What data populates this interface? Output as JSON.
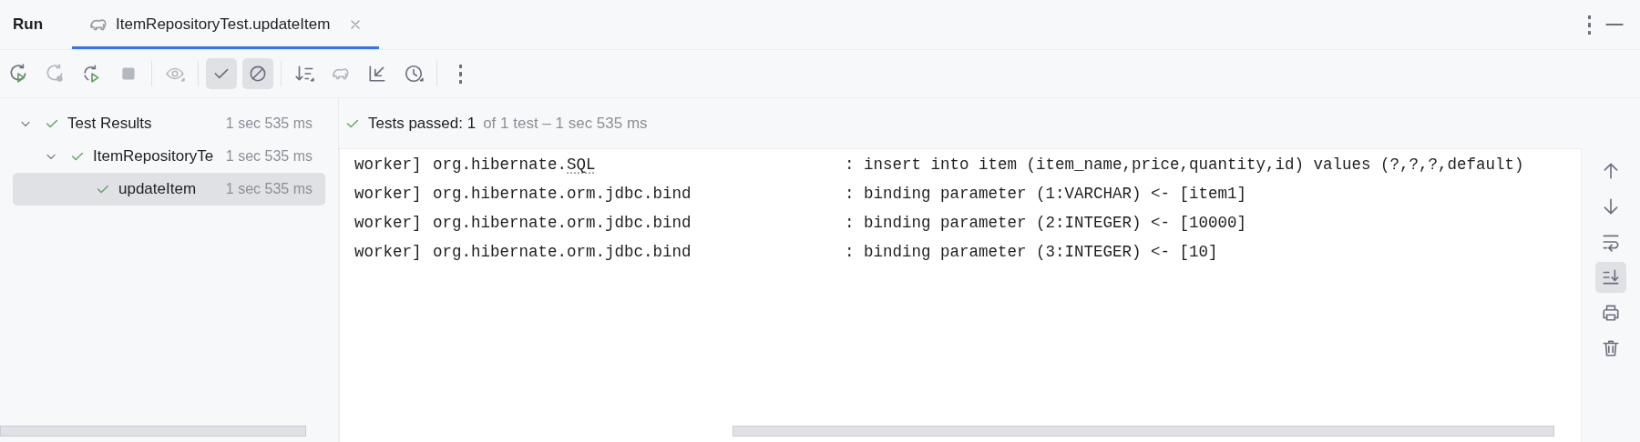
{
  "tool_window": {
    "title": "Run"
  },
  "tabs": [
    {
      "label": "ItemRepositoryTest.updateItem",
      "selected": true
    }
  ],
  "toolbar": [
    {
      "kind": "rerun",
      "disabled": false,
      "selected": false
    },
    {
      "kind": "rerun-failed",
      "disabled": true,
      "selected": false
    },
    {
      "kind": "toggle-auto-test",
      "disabled": false,
      "selected": false
    },
    {
      "kind": "stop",
      "disabled": true,
      "selected": false
    },
    {
      "kind": "separator"
    },
    {
      "kind": "eye",
      "disabled": true,
      "selected": false
    },
    {
      "kind": "separator"
    },
    {
      "kind": "check",
      "disabled": false,
      "selected": true
    },
    {
      "kind": "ignored",
      "disabled": false,
      "selected": true
    },
    {
      "kind": "separator"
    },
    {
      "kind": "sort",
      "disabled": false,
      "selected": false
    },
    {
      "kind": "elephant",
      "disabled": true,
      "selected": false
    },
    {
      "kind": "import",
      "disabled": false,
      "selected": false
    },
    {
      "kind": "history",
      "disabled": false,
      "selected": false
    },
    {
      "kind": "separator"
    },
    {
      "kind": "more",
      "disabled": false,
      "selected": false
    }
  ],
  "tree": [
    {
      "label": "Test Results",
      "time": "1 sec 535 ms",
      "passed": true,
      "expanded": true,
      "selected": false,
      "children": [
        {
          "label": "ItemRepositoryTe",
          "time": "1 sec 535 ms",
          "passed": true,
          "expanded": true,
          "selected": false,
          "children": [
            {
              "label": "updateItem",
              "time": "1 sec 535 ms",
              "passed": true,
              "selected": true
            }
          ]
        }
      ]
    }
  ],
  "status": {
    "passed": true,
    "label": "Tests passed: 1",
    "detail": "of 1 test – 1 sec 535 ms"
  },
  "console": [
    {
      "thread": "worker]",
      "logger": [
        {
          "text": "org.hibernate.",
          "flagged": false
        },
        {
          "text": "SQL",
          "flagged": true
        }
      ],
      "message": ": insert into item (item_name,price,quantity,id) values (?,?,?,default)"
    },
    {
      "thread": "worker]",
      "logger": [
        {
          "text": "org.hibernate.orm.jdbc.bind",
          "flagged": false
        }
      ],
      "message": ": binding parameter (1:VARCHAR) <- [item1]"
    },
    {
      "thread": "worker]",
      "logger": [
        {
          "text": "org.hibernate.orm.jdbc.bind",
          "flagged": false
        }
      ],
      "message": ": binding parameter (2:INTEGER) <- [10000]"
    },
    {
      "thread": "worker]",
      "logger": [
        {
          "text": "org.hibernate.orm.jdbc.bind",
          "flagged": false
        }
      ],
      "message": ": binding parameter (3:INTEGER) <- [10]"
    }
  ],
  "console_actions": [
    {
      "kind": "up",
      "selected": false
    },
    {
      "kind": "down",
      "selected": false
    },
    {
      "kind": "wrap",
      "selected": false
    },
    {
      "kind": "scroll-end",
      "selected": true
    },
    {
      "kind": "print",
      "selected": false
    },
    {
      "kind": "trash",
      "selected": false
    }
  ]
}
